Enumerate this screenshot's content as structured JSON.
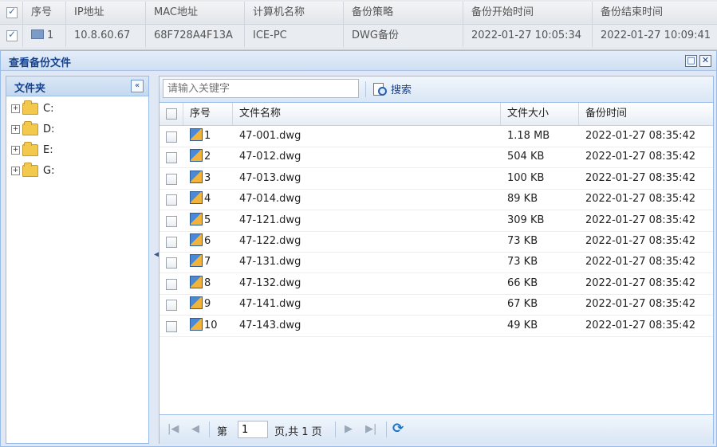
{
  "background_table": {
    "headers": [
      "序号",
      "IP地址",
      "MAC地址",
      "计算机名称",
      "备份策略",
      "备份开始时间",
      "备份结束时间"
    ],
    "row": {
      "index": "1",
      "ip": "10.8.60.67",
      "mac": "68F728A4F13A",
      "computer": "ICE-PC",
      "policy": "DWG备份",
      "start": "2022-01-27 10:05:34",
      "end": "2022-01-27 10:09:41"
    }
  },
  "window": {
    "title": "查看备份文件",
    "buttons": [
      "maximize-icon",
      "close-icon"
    ],
    "restore_glyph": "□",
    "close_glyph": "✕"
  },
  "folder_panel": {
    "title": "文件夹",
    "collapse_glyph": "«",
    "expander_glyph": "+",
    "drives": [
      "C:",
      "D:",
      "E:",
      "G:"
    ]
  },
  "toolbar": {
    "search_placeholder": "请输入关键字",
    "search_label": "搜索"
  },
  "file_grid": {
    "headers": [
      "序号",
      "文件名称",
      "文件大小",
      "备份时间"
    ],
    "rows": [
      {
        "index": "1",
        "name": "47-001.dwg",
        "size": "1.18 MB",
        "time": "2022-01-27 08:35:42"
      },
      {
        "index": "2",
        "name": "47-012.dwg",
        "size": "504 KB",
        "time": "2022-01-27 08:35:42"
      },
      {
        "index": "3",
        "name": "47-013.dwg",
        "size": "100 KB",
        "time": "2022-01-27 08:35:42"
      },
      {
        "index": "4",
        "name": "47-014.dwg",
        "size": "89 KB",
        "time": "2022-01-27 08:35:42"
      },
      {
        "index": "5",
        "name": "47-121.dwg",
        "size": "309 KB",
        "time": "2022-01-27 08:35:42"
      },
      {
        "index": "6",
        "name": "47-122.dwg",
        "size": "73 KB",
        "time": "2022-01-27 08:35:42"
      },
      {
        "index": "7",
        "name": "47-131.dwg",
        "size": "73 KB",
        "time": "2022-01-27 08:35:42"
      },
      {
        "index": "8",
        "name": "47-132.dwg",
        "size": "66 KB",
        "time": "2022-01-27 08:35:42"
      },
      {
        "index": "9",
        "name": "47-141.dwg",
        "size": "67 KB",
        "time": "2022-01-27 08:35:42"
      },
      {
        "index": "10",
        "name": "47-143.dwg",
        "size": "49 KB",
        "time": "2022-01-27 08:35:42"
      }
    ]
  },
  "pager": {
    "first_glyph": "|◀",
    "prev_glyph": "◀",
    "page_prefix": "第",
    "page_value": "1",
    "page_suffix": "页,共 1 页",
    "next_glyph": "▶",
    "last_glyph": "▶|",
    "refresh_glyph": "⟳"
  },
  "splitter_glyph": "◀",
  "colors": {
    "header_text": "#15428b",
    "panel_border": "#99bbe8",
    "title_bg": "#cfdff3"
  }
}
